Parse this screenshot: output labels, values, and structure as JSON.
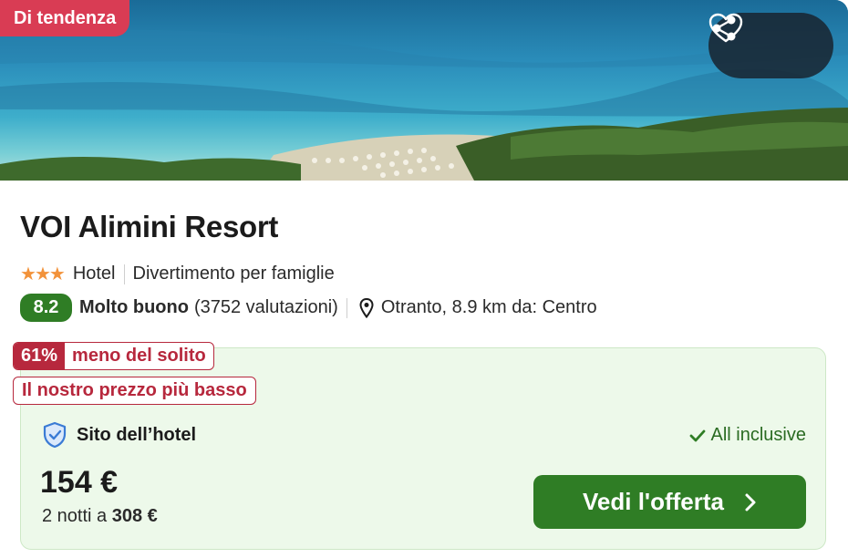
{
  "hero": {
    "badge": "Di tendenza",
    "actions": [
      {
        "icon": "share-icon"
      },
      {
        "icon": "heart-icon"
      }
    ]
  },
  "hotel": {
    "name": "VOI Alimini Resort",
    "stars": 3,
    "type": "Hotel",
    "category": "Divertimento per famiglie",
    "score": "8.2",
    "rating_label": "Molto buono",
    "reviews": "(3752 valutazioni)",
    "location": "Otranto, 8.9 km da: Centro"
  },
  "deal": {
    "discount_pct": "61%",
    "discount_text": "meno del solito",
    "lowest_label": "Il nostro prezzo più basso",
    "source": "Sito dell’hotel",
    "board": "All inclusive",
    "price": "154 €",
    "nights_prefix": "2 notti a",
    "total": "308 €",
    "cta": "Vedi l'offerta"
  },
  "colors": {
    "badge_red": "#d93c54",
    "deal_red": "#b7283d",
    "green": "#2f7d25",
    "deal_bg": "#edf9ea",
    "star": "#f2923a"
  }
}
